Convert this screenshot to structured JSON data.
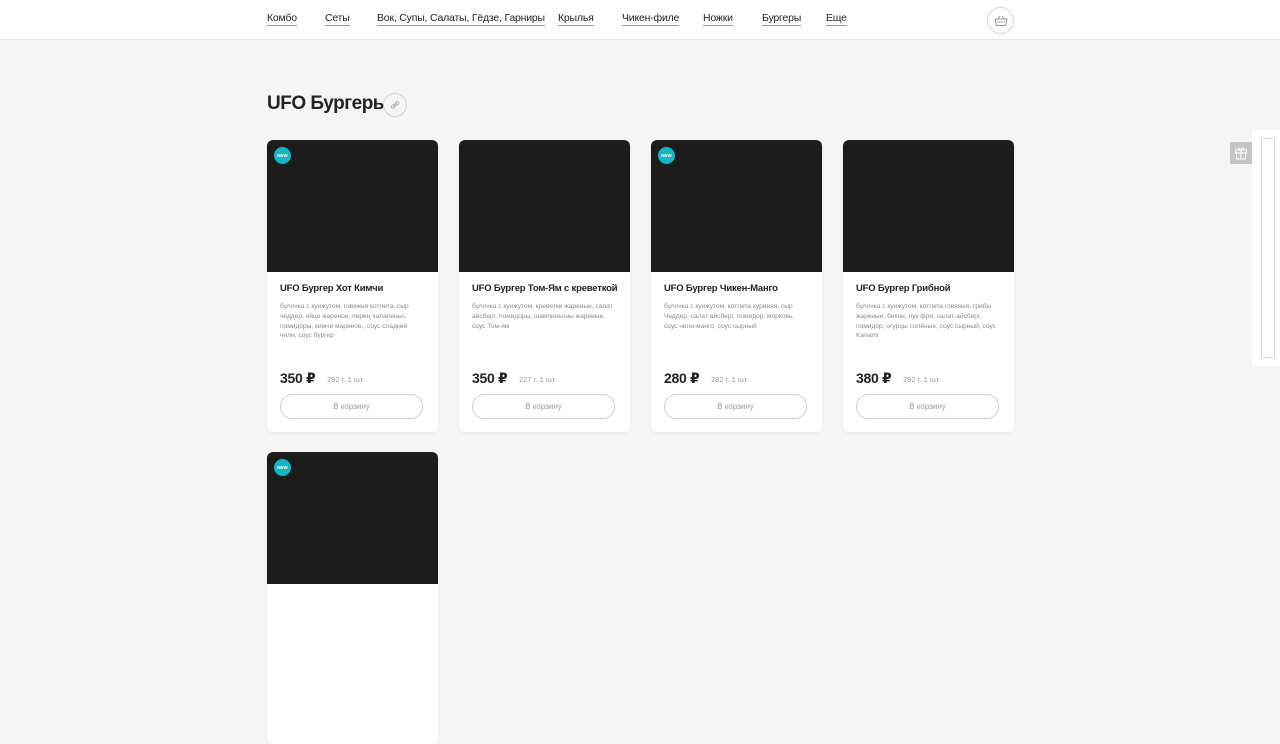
{
  "nav": {
    "items": [
      {
        "label": "Комбо"
      },
      {
        "label": "Сеты"
      },
      {
        "label": "Вок, Супы, Салаты, Гёдзе, Гарниры"
      },
      {
        "label": "Крылья"
      },
      {
        "label": "Чикен-филе"
      },
      {
        "label": "Ножки"
      },
      {
        "label": "Бургеры"
      },
      {
        "label": "Еще"
      }
    ],
    "cart_icon": "basket-icon"
  },
  "section": {
    "title": "UFO Бургеры",
    "link_icon": "link-icon"
  },
  "colors": {
    "badge": "#14b6c4",
    "card_image_bg": "#1c1c1c",
    "bun": "#c9773e"
  },
  "products": [
    {
      "badge": "NEW",
      "title": "UFO Бургер Хот Кимчи",
      "description": "булочка с кунжутом, говяжья котлета, сыр чеддер, яйцо жареное, перец халапеньо, помидоры, кимчи маринов., соус сладкий чили, соус бургер",
      "price": "350 ₽",
      "weight": "292 г. 1 шт.",
      "button": "В корзину"
    },
    {
      "badge": "",
      "title": "UFO Бургер Том-Ям с креветкой",
      "description": "булочка с кунжутом, креветки жареные, салат айсберг, помидоры, шампиньоны жареные, соус Том-ям",
      "price": "350 ₽",
      "weight": "227 г. 1 шт.",
      "button": "В корзину"
    },
    {
      "badge": "NEW",
      "title": "UFO Бургер Чикен-Манго",
      "description": "булочка с кунжутом, котлета куриная, сыр Чеддер, салат айсберг, помидор, морковь, соус чили-манго, соус сырный",
      "price": "280 ₽",
      "weight": "282 г. 1 шт.",
      "button": "В корзину"
    },
    {
      "badge": "",
      "title": "UFO Бургер Грибной",
      "description": "булочка с кунжутом, котлета говяжья, грибы жареные, бекон, лук фри, салат-айсберг, помидор, огурцы солёные, соус сырный, соус Kanami",
      "price": "380 ₽",
      "weight": "292 г. 1 шт.",
      "button": "В корзину"
    },
    {
      "badge": "NEW",
      "title": "",
      "description": "",
      "price": "",
      "weight": "",
      "button": ""
    }
  ],
  "side": {
    "gift_icon": "gift-icon"
  }
}
